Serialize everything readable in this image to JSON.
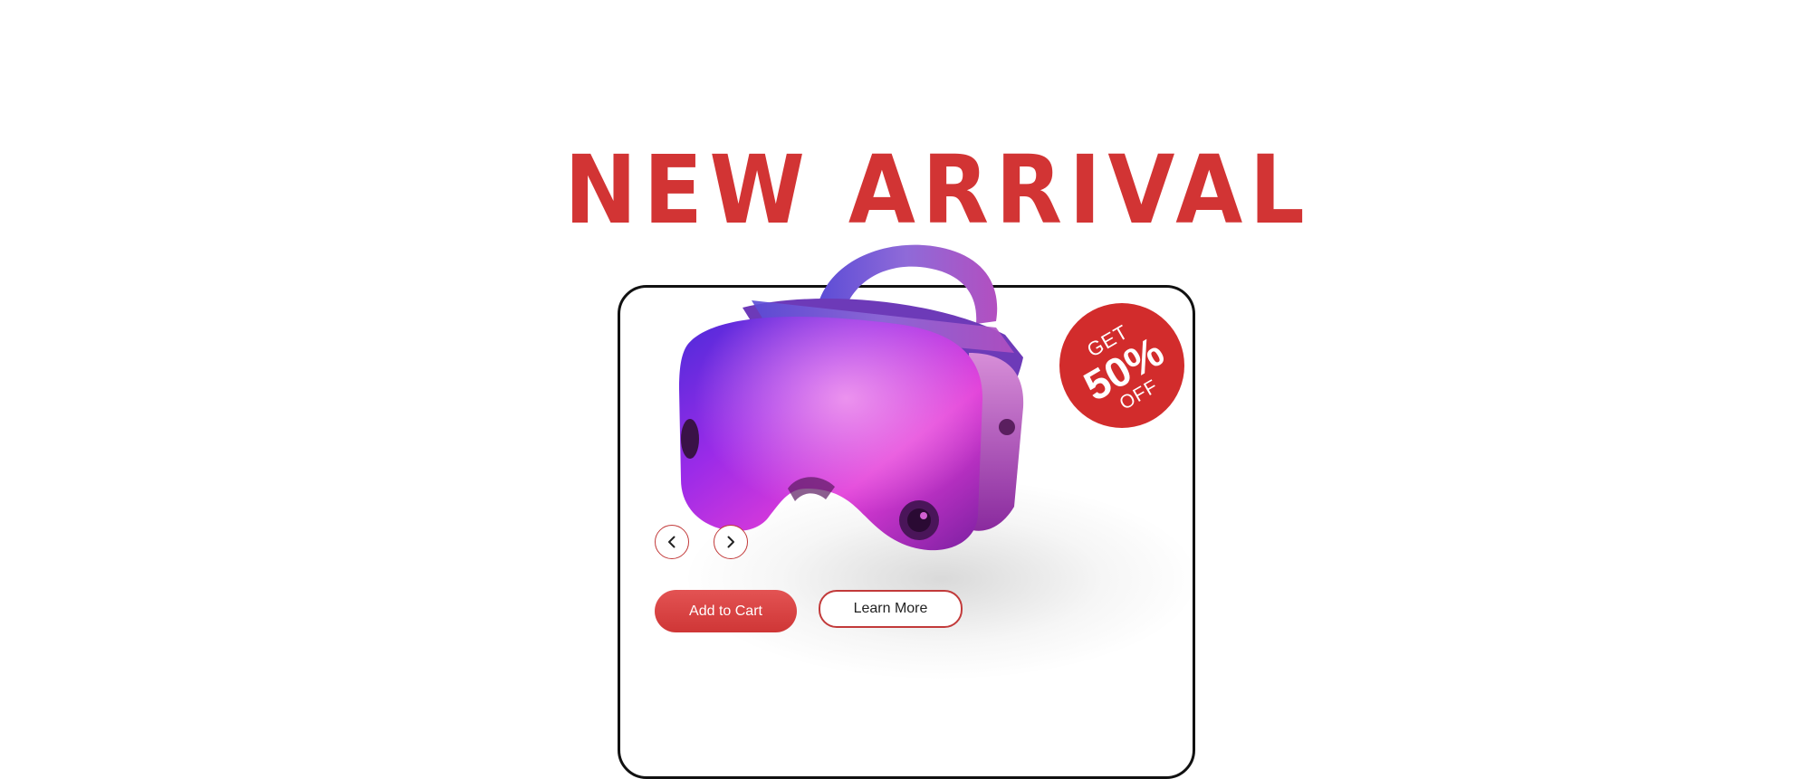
{
  "hero": {
    "headline": "NEW ARRIVAL"
  },
  "promo_badge": {
    "line1": "GET",
    "line2": "50%",
    "line3": "OFF",
    "color": "#d22c2c"
  },
  "product": {
    "image_icon": "vr-headset-icon"
  },
  "carousel": {
    "prev_icon": "chevron-left-icon",
    "next_icon": "chevron-right-icon"
  },
  "actions": {
    "add_to_cart_label": "Add to Cart",
    "learn_more_label": "Learn More"
  },
  "colors": {
    "accent": "#d23434",
    "card_border": "#111111",
    "background": "#ffffff"
  }
}
